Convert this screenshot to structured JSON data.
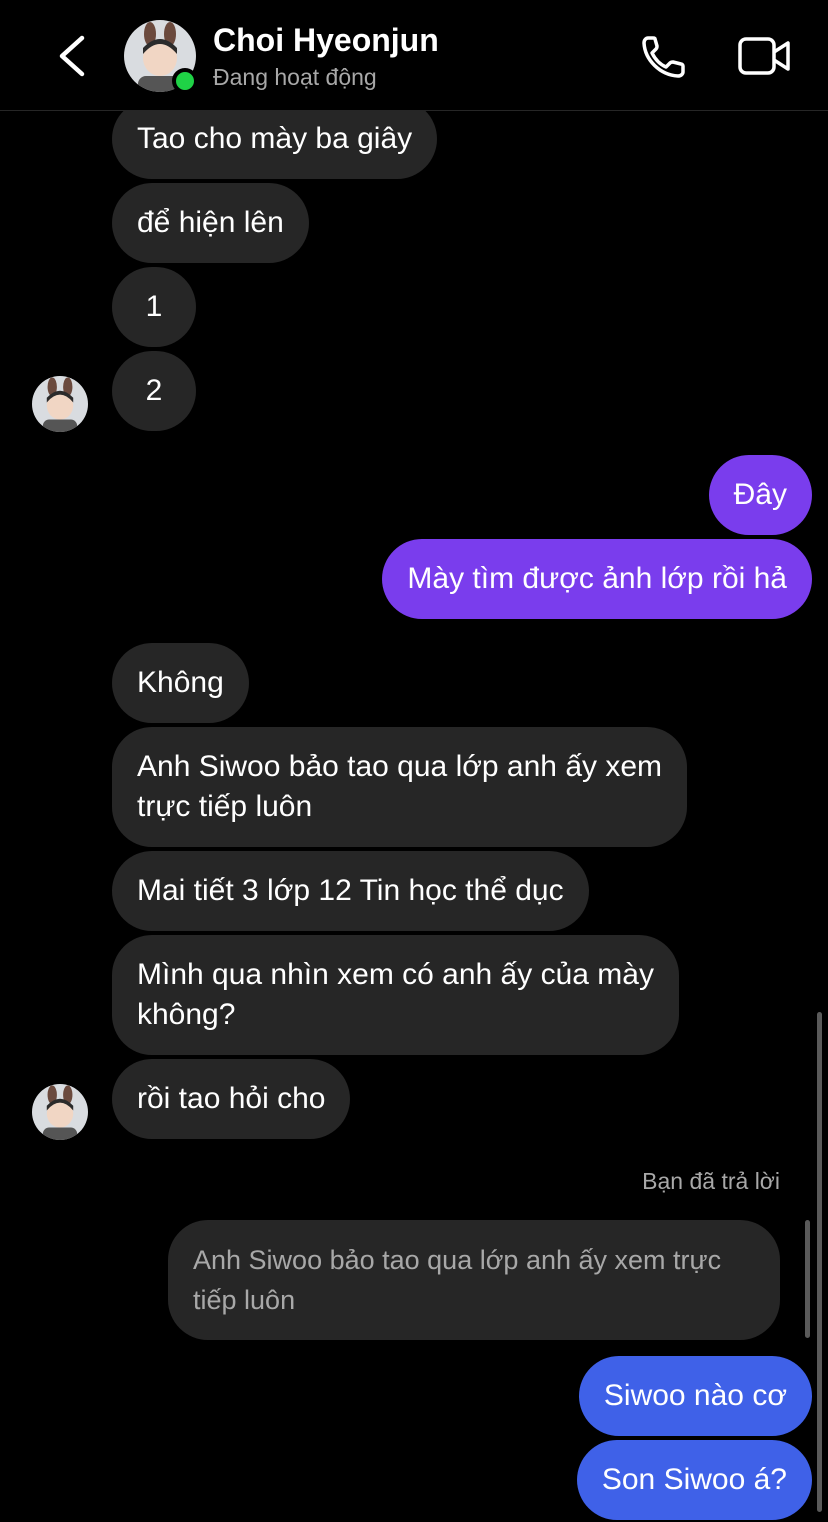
{
  "header": {
    "contact_name": "Choi Hyeonjun",
    "status": "Đang hoạt động",
    "icons": {
      "back": "chevron-left-icon",
      "call": "phone-icon",
      "video": "video-camera-icon"
    },
    "colors": {
      "online": "#1fd246"
    }
  },
  "messages": {
    "recv_1": "Tao cho mày ba giây",
    "recv_2": "để hiện lên",
    "recv_3": "1",
    "recv_4": "2",
    "sent_1": "Đây",
    "sent_2": "Mày tìm được ảnh lớp rồi hả",
    "recv_5": "Không",
    "recv_6_line1": "Anh Siwoo bảo tao qua lớp anh ấy xem",
    "recv_6_line2": "trực tiếp luôn",
    "recv_7": "Mai tiết 3 lớp 12 Tin học thể dục",
    "recv_8_line1": "Mình qua nhìn xem có anh ấy của mày",
    "recv_8_line2": "không?",
    "recv_9": "rồi tao hỏi cho",
    "reply_label": "Bạn đã trả lời",
    "reply_quote_line1": "Anh Siwoo bảo tao qua lớp anh ấy xem trực",
    "reply_quote_line2": "tiếp luôn",
    "sent_3": "Siwoo nào cơ",
    "sent_4": "Son Siwoo á?"
  },
  "colors": {
    "received_bubble": "#262626",
    "sent_bubble_purple": "#7a3ded",
    "sent_bubble_blue": "#3f61e8"
  }
}
